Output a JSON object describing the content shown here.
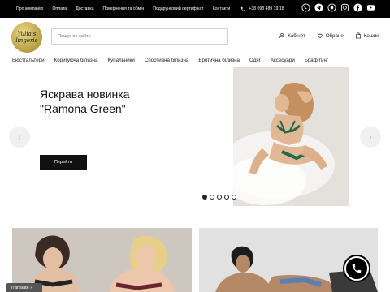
{
  "topbar": {
    "links": [
      "Про компанію",
      "Оплата",
      "Доставка",
      "Повернення та обмін",
      "Подарунковий сертифікат",
      "Контакти"
    ],
    "phone": "+38 098 489 19 18",
    "social_icons": [
      "viber-icon",
      "telegram-icon",
      "whatsapp-icon",
      "instagram-icon",
      "facebook-icon",
      "youtube-icon"
    ]
  },
  "header": {
    "logo_line1": "Yulia's",
    "logo_line2": "lingerie",
    "search_placeholder": "Пошук по сайту",
    "cabinet": "Кабінет",
    "favorites": "Обране",
    "cart": "Кошик"
  },
  "categories": [
    "Бюстгальтери",
    "Коригуюча білизна",
    "Купальники",
    "Спортивна білизна",
    "Еротична білизна",
    "Одяг",
    "Аксесуари",
    "Брафітинг"
  ],
  "hero": {
    "title_line1": "Яскрава новинка",
    "title_line2": "\"Ramona Green\"",
    "button": "Перейти",
    "prev_arrow": "‹",
    "next_arrow": "›",
    "slide_count": 5,
    "active_slide": 1
  },
  "translate_label": "Translate »",
  "colors": {
    "topbar": "#000000",
    "accent_green": "#1f6b4a",
    "button": "#111111"
  }
}
